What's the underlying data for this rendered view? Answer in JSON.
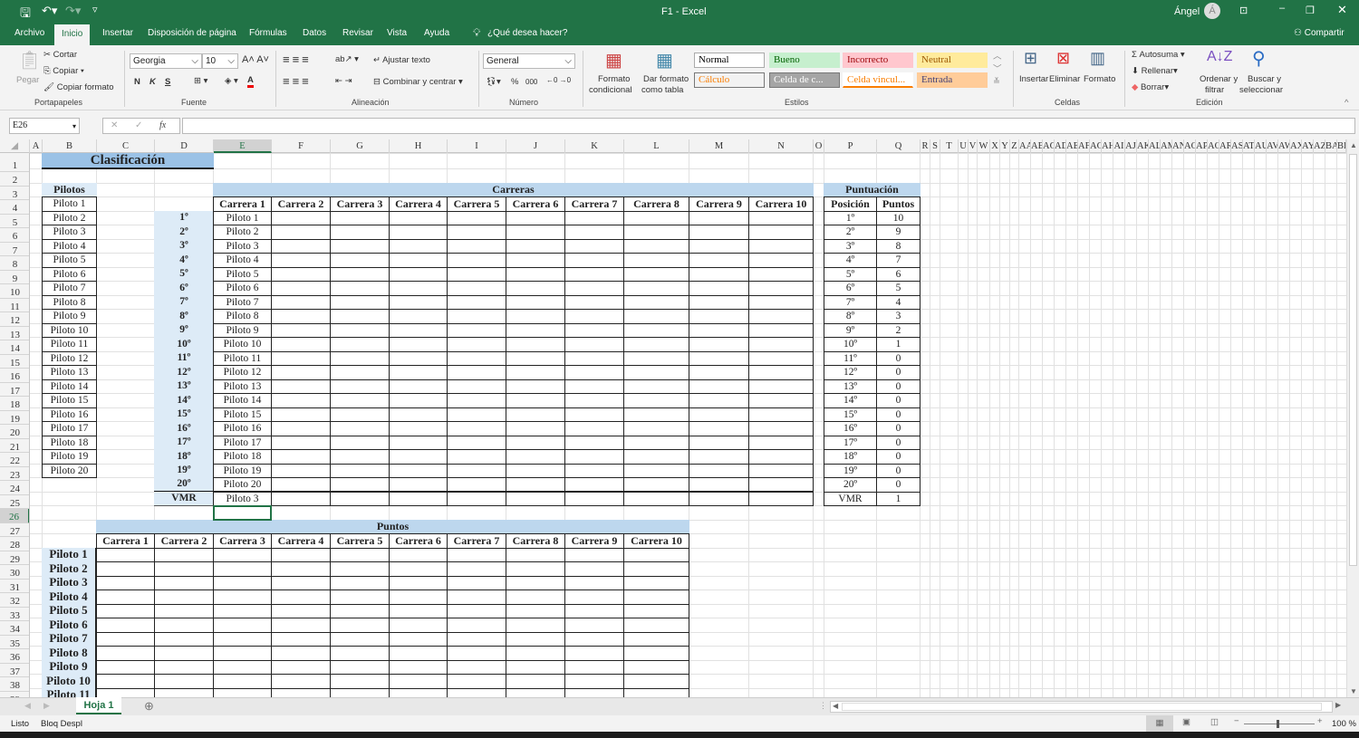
{
  "app": {
    "title": "F1  -  Excel",
    "user": "Ángel",
    "avatar_initial": "Á",
    "share": "Compartir"
  },
  "menu": [
    "Archivo",
    "Inicio",
    "Insertar",
    "Disposición de página",
    "Fórmulas",
    "Datos",
    "Revisar",
    "Vista",
    "Ayuda"
  ],
  "tell_me": "¿Qué desea hacer?",
  "ribbon": {
    "clipboard": {
      "paste": "Pegar",
      "cut": "Cortar",
      "copy": "Copiar",
      "format_painter": "Copiar formato",
      "group": "Portapapeles"
    },
    "font": {
      "name": "Georgia",
      "size": "10",
      "bold": "N",
      "italic": "K",
      "underline": "S",
      "group": "Fuente"
    },
    "alignment": {
      "wrap": "Ajustar texto",
      "merge": "Combinar y centrar",
      "group": "Alineación"
    },
    "number": {
      "format": "General",
      "percent": "%",
      "thousands": "000",
      "group": "Número"
    },
    "styles": {
      "cond_format_1": "Formato",
      "cond_format_2": "condicional",
      "table_format_1": "Dar formato",
      "table_format_2": "como tabla",
      "items": [
        {
          "label": "Normal",
          "bg": "#ffffff",
          "fg": "#000000"
        },
        {
          "label": "Bueno",
          "bg": "#c6efce",
          "fg": "#006100"
        },
        {
          "label": "Incorrecto",
          "bg": "#ffc7ce",
          "fg": "#9c0006"
        },
        {
          "label": "Neutral",
          "bg": "#ffeb9c",
          "fg": "#9c5700"
        },
        {
          "label": "Cálculo",
          "bg": "#f2f2f2",
          "fg": "#fa7d00"
        },
        {
          "label": "Celda de c...",
          "bg": "#a5a5a5",
          "fg": "#ffffff"
        },
        {
          "label": "Celda vincul...",
          "bg": "#ffffff",
          "fg": "#fa7d00"
        },
        {
          "label": "Entrada",
          "bg": "#ffcc99",
          "fg": "#3f3f76"
        }
      ],
      "group": "Estilos"
    },
    "cells": {
      "insert": "Insertar",
      "delete": "Eliminar",
      "format": "Formato",
      "group": "Celdas"
    },
    "editing": {
      "autosum": "Autosuma",
      "fill": "Rellenar",
      "clear": "Borrar",
      "sort_1": "Ordenar y",
      "sort_2": "filtrar",
      "find_1": "Buscar y",
      "find_2": "seleccionar",
      "group": "Edición"
    }
  },
  "formula_bar": {
    "name_box": "E26",
    "cancel": "✕",
    "enter": "✓",
    "fx": "fx",
    "value": ""
  },
  "columns": [
    "A",
    "B",
    "C",
    "D",
    "E",
    "F",
    "G",
    "H",
    "I",
    "J",
    "K",
    "L",
    "M",
    "N",
    "O",
    "P",
    "Q",
    "R",
    "S",
    "T",
    "U",
    "V",
    "W",
    "X",
    "Y",
    "Z",
    "AA",
    "AB",
    "AC",
    "AD",
    "AE",
    "AF",
    "AG",
    "AH",
    "AI",
    "AJ",
    "AK",
    "AL",
    "AM",
    "AN",
    "AO",
    "AP",
    "AQ",
    "AR",
    "AS",
    "AT",
    "AU",
    "AV",
    "AW",
    "AX",
    "AY",
    "AZ",
    "BA",
    "BB"
  ],
  "selected_cell": {
    "column": "E",
    "row": 26
  },
  "sheet": {
    "title": "Clasificación",
    "pilotos_header": "Pilotos",
    "pilotos": [
      "Piloto 1",
      "Piloto 2",
      "Piloto 3",
      "Piloto 4",
      "Piloto 5",
      "Piloto 6",
      "Piloto 7",
      "Piloto 8",
      "Piloto 9",
      "Piloto 10",
      "Piloto 11",
      "Piloto 12",
      "Piloto 13",
      "Piloto 14",
      "Piloto 15",
      "Piloto 16",
      "Piloto 17",
      "Piloto 18",
      "Piloto 19",
      "Piloto 20"
    ],
    "carreras_header": "Carreras",
    "carreras": [
      "Carrera 1",
      "Carrera 2",
      "Carrera 3",
      "Carrera 4",
      "Carrera 5",
      "Carrera 6",
      "Carrera 7",
      "Carrera 8",
      "Carrera 9",
      "Carrera 10"
    ],
    "posiciones": [
      "1º",
      "2º",
      "3º",
      "4º",
      "5º",
      "6º",
      "7º",
      "8º",
      "9º",
      "10º",
      "11º",
      "12º",
      "13º",
      "14º",
      "15º",
      "16º",
      "17º",
      "18º",
      "19º",
      "20º",
      "VMR"
    ],
    "carrera1_results": [
      "Piloto 1",
      "Piloto 2",
      "Piloto 3",
      "Piloto 4",
      "Piloto 5",
      "Piloto 6",
      "Piloto 7",
      "Piloto 8",
      "Piloto 9",
      "Piloto 10",
      "Piloto 11",
      "Piloto 12",
      "Piloto 13",
      "Piloto 14",
      "Piloto 15",
      "Piloto 16",
      "Piloto 17",
      "Piloto 18",
      "Piloto 19",
      "Piloto 20",
      "Piloto 3"
    ],
    "puntuacion_header": "Puntuación",
    "puntuacion_cols": [
      "Posición",
      "Puntos"
    ],
    "puntos_por_posicion": [
      "10",
      "9",
      "8",
      "7",
      "6",
      "5",
      "4",
      "3",
      "2",
      "1",
      "0",
      "0",
      "0",
      "0",
      "0",
      "0",
      "0",
      "0",
      "0",
      "0",
      "1"
    ],
    "puntos_header": "Puntos",
    "puntos_pilotos": [
      "Piloto 1",
      "Piloto 2",
      "Piloto 3",
      "Piloto 4",
      "Piloto 5",
      "Piloto 6",
      "Piloto 7",
      "Piloto 8",
      "Piloto 9",
      "Piloto 10",
      "Piloto 11"
    ]
  },
  "sheet_tabs": [
    "Hoja 1"
  ],
  "status": {
    "ready": "Listo",
    "scroll_lock": "Bloq Despl",
    "zoom": "100 %"
  },
  "colors": {
    "excel_green": "#217346",
    "header_blue": "#bdd7ee",
    "position_blue": "#ddebf7",
    "title_blue": "#9bc2e6"
  }
}
